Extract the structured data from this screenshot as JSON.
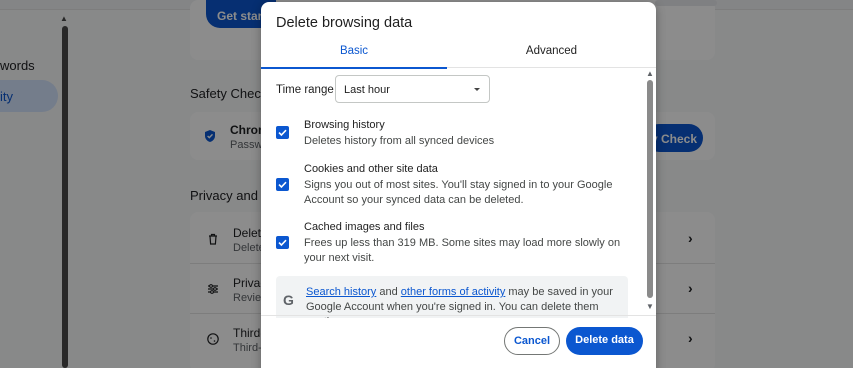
{
  "background": {
    "sidebar": {
      "items": [
        {
          "label": "words"
        },
        {
          "label": "ity"
        }
      ]
    },
    "get_started_label": "Get start",
    "safety_check": {
      "title": "Safety Check",
      "row_title": "Chrom",
      "row_sub": "Passw",
      "button_label": "y Check"
    },
    "privacy": {
      "title": "Privacy and se",
      "rows": [
        {
          "title": "Delete",
          "sub": "Delete"
        },
        {
          "title": "Privac",
          "sub": "Review"
        },
        {
          "title": "Third-",
          "sub": "Third-"
        }
      ]
    }
  },
  "dialog": {
    "title": "Delete browsing data",
    "tabs": [
      {
        "label": "Basic",
        "active": true
      },
      {
        "label": "Advanced",
        "active": false
      }
    ],
    "time_range": {
      "label": "Time range",
      "value": "Last hour"
    },
    "options": [
      {
        "title": "Browsing history",
        "description": "Deletes history from all synced devices",
        "checked": true
      },
      {
        "title": "Cookies and other site data",
        "description": "Signs you out of most sites. You'll stay signed in to your Google Account so your synced data can be deleted.",
        "checked": true
      },
      {
        "title": "Cached images and files",
        "description": "Frees up less than 319 MB. Some sites may load more slowly on your next visit.",
        "checked": true
      }
    ],
    "info": {
      "link1": "Search history",
      "and_text": " and ",
      "link2": "other forms of activity",
      "rest": " may be saved in your Google Account when you're signed in. You can delete them anytime."
    },
    "buttons": {
      "cancel": "Cancel",
      "delete": "Delete data"
    }
  },
  "colors": {
    "accent": "#0b57d0",
    "scrim": "#000000"
  }
}
